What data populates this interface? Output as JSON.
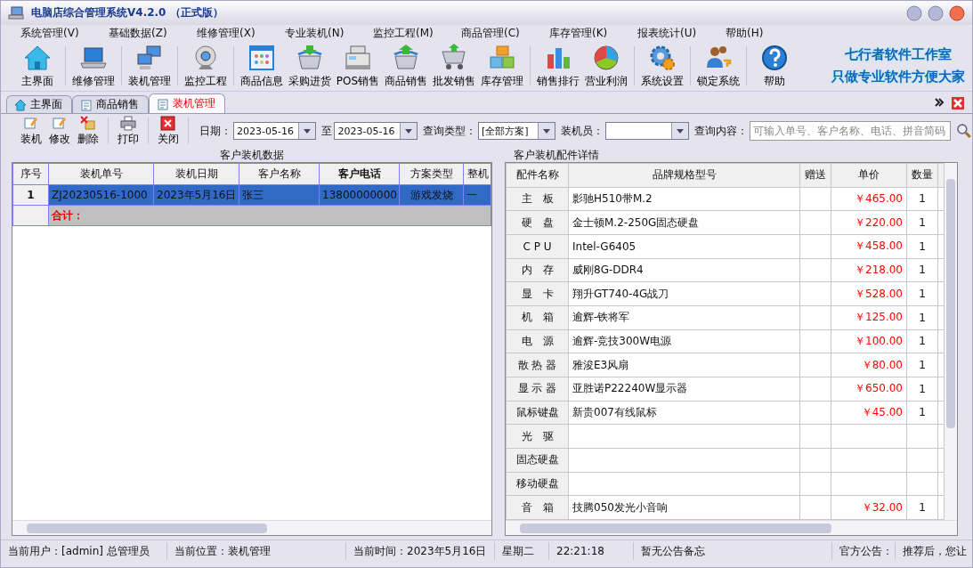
{
  "window": {
    "title": "电脑店综合管理系统V4.2.0 （正式版）"
  },
  "menu": [
    "系统管理(V)",
    "基础数据(Z)",
    "维修管理(X)",
    "专业装机(N)",
    "监控工程(M)",
    "商品管理(C)",
    "库存管理(K)",
    "报表统计(U)",
    "帮助(H)"
  ],
  "toolbar": [
    {
      "label": "主界面"
    },
    {
      "label": "维修管理"
    },
    {
      "label": "装机管理"
    },
    {
      "label": "监控工程"
    },
    {
      "label": "商品信息"
    },
    {
      "label": "采购进货"
    },
    {
      "label": "POS销售"
    },
    {
      "label": "商品销售"
    },
    {
      "label": "批发销售"
    },
    {
      "label": "库存管理"
    },
    {
      "label": "销售排行"
    },
    {
      "label": "营业利润"
    },
    {
      "label": "系统设置"
    },
    {
      "label": "锁定系统"
    },
    {
      "label": "帮助"
    }
  ],
  "slogan": [
    "七行者软件工作室",
    "只做专业软件方便大家"
  ],
  "tabs": [
    {
      "label": "主界面",
      "selected": false
    },
    {
      "label": "商品销售",
      "selected": false
    },
    {
      "label": "装机管理",
      "selected": true
    }
  ],
  "actions": [
    "装机",
    "修改",
    "删除",
    "打印",
    "关闭"
  ],
  "filters": {
    "date_label": "日期：",
    "date_from": "2023-05-16",
    "to_label": "至",
    "date_to": "2023-05-16",
    "type_label": "查询类型：",
    "type_value": "[全部方案]",
    "installer_label": "装机员：",
    "query_label": "查询内容：",
    "query_placeholder": "可输入单号、客户名称、电话、拼音简码"
  },
  "orders": {
    "title": "客户装机数据",
    "columns": [
      "序号",
      "装机单号",
      "装机日期",
      "客户名称",
      "客户电话",
      "方案类型",
      "整机"
    ],
    "rows": [
      {
        "cells": [
          "1",
          "ZJ20230516-1000",
          "2023年5月16日",
          "张三",
          "13800000000",
          "游戏发烧",
          "一"
        ],
        "selected": true
      }
    ],
    "total_label": "合计："
  },
  "parts": {
    "title": "客户装机配件详情",
    "columns": [
      "配件名称",
      "品牌规格型号",
      "赠送",
      "单价",
      "数量"
    ],
    "rows": [
      {
        "name": "主　板",
        "model": "影驰H510带M.2",
        "price": "￥465.00",
        "qty": "1"
      },
      {
        "name": "硬　盘",
        "model": "金士顿M.2-250G固态硬盘",
        "price": "￥220.00",
        "qty": "1"
      },
      {
        "name": "C P U",
        "model": "Intel-G6405",
        "price": "￥458.00",
        "qty": "1"
      },
      {
        "name": "内　存",
        "model": "威刚8G-DDR4",
        "price": "￥218.00",
        "qty": "1"
      },
      {
        "name": "显　卡",
        "model": "翔升GT740-4G战刀",
        "price": "￥528.00",
        "qty": "1"
      },
      {
        "name": "机　箱",
        "model": "逾辉-铁将军",
        "price": "￥125.00",
        "qty": "1"
      },
      {
        "name": "电　源",
        "model": "逾辉-竞技300W电源",
        "price": "￥100.00",
        "qty": "1"
      },
      {
        "name": "散 热 器",
        "model": "雅浚E3风扇",
        "price": "￥80.00",
        "qty": "1"
      },
      {
        "name": "显 示 器",
        "model": "亚胜诺P22240W显示器",
        "price": "￥650.00",
        "qty": "1"
      },
      {
        "name": "鼠标键盘",
        "model": "新贵007有线鼠标",
        "price": "￥45.00",
        "qty": "1"
      },
      {
        "name": "光　驱"
      },
      {
        "name": "固态硬盘"
      },
      {
        "name": "移动硬盘"
      },
      {
        "name": "音　箱",
        "model": "技腾050发光小音响",
        "price": "￥32.00",
        "qty": "1"
      }
    ]
  },
  "status_bar": [
    "当前用户：[admin] 总管理员",
    "当前位置：装机管理",
    "当前时间：2023年5月16日",
    "星期二",
    "22:21:18",
    "暂无公告备忘",
    "官方公告：",
    "推荐后，您让"
  ]
}
